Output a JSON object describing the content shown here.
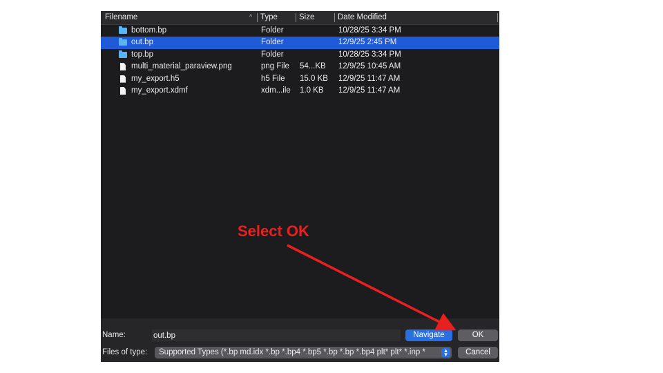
{
  "columns": {
    "filename": "Filename",
    "sort_indicator": "^",
    "type": "Type",
    "size": "Size",
    "date_modified": "Date Modified"
  },
  "files": [
    {
      "name": "bottom.bp",
      "type": "Folder",
      "size": "",
      "date": "10/28/25 3:34 PM",
      "icon": "folder-icon",
      "selected": false
    },
    {
      "name": "out.bp",
      "type": "Folder",
      "size": "",
      "date": "12/9/25 2:45 PM",
      "icon": "folder-icon",
      "selected": true
    },
    {
      "name": "top.bp",
      "type": "Folder",
      "size": "",
      "date": "10/28/25 3:34 PM",
      "icon": "folder-icon",
      "selected": false
    },
    {
      "name": "multi_material_paraview.png",
      "type": "png File",
      "size": "54...KB",
      "date": "12/9/25 10:45 AM",
      "icon": "file-icon",
      "selected": false
    },
    {
      "name": "my_export.h5",
      "type": "h5 File",
      "size": "15.0 KB",
      "date": "12/9/25 11:47 AM",
      "icon": "file-icon",
      "selected": false
    },
    {
      "name": "my_export.xdmf",
      "type": "xdm...ile",
      "size": "1.0 KB",
      "date": "12/9/25 11:47 AM",
      "icon": "file-icon",
      "selected": false
    }
  ],
  "bottom": {
    "name_label": "Name:",
    "name_value": "out.bp",
    "navigate_label": "Navigate",
    "ok_label": "OK",
    "files_of_type_label": "Files of type:",
    "files_of_type_value": "Supported Types (*.bp md.idx *.bp *.bp4 *.bp5 *.bp *.bp *.bp4 plt* plt* *.inp *",
    "cancel_label": "Cancel"
  },
  "annotation": {
    "text": "Select OK"
  },
  "colors": {
    "selection": "#1f5bd8",
    "folder": "#5ab4f0",
    "annotation": "#e8201e",
    "primary_button": "#2a6fe0"
  }
}
